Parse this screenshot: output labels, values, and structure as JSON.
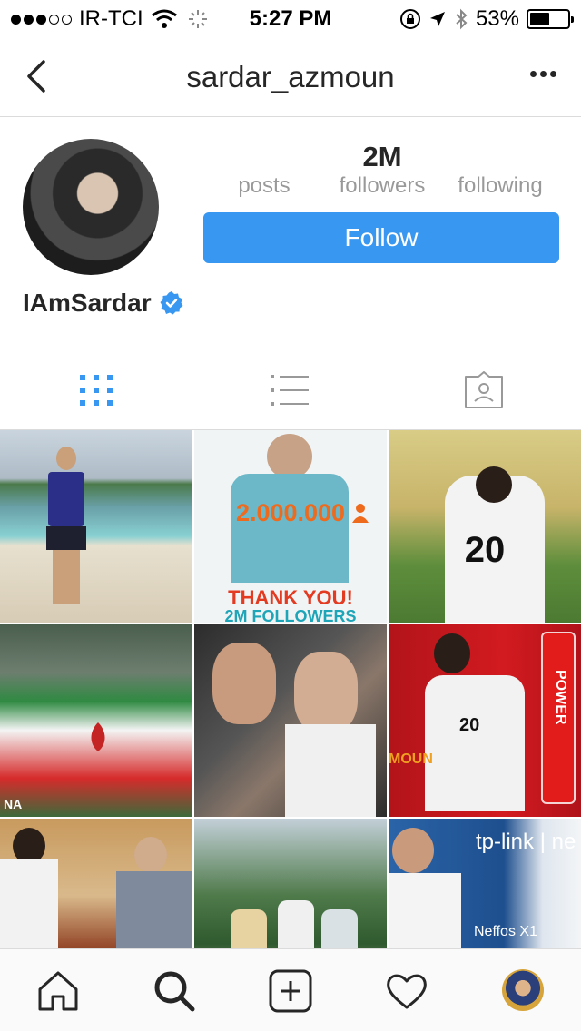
{
  "status_bar": {
    "carrier": "IR-TCI",
    "time": "5:27 PM",
    "battery": "53%",
    "battery_level": 0.53,
    "signal_bars_filled": 3,
    "signal_bars_total": 5
  },
  "nav": {
    "title": "sardar_azmoun",
    "back_icon": "chevron-left-icon",
    "more_icon": "more-horizontal-icon"
  },
  "profile": {
    "posts_label": "posts",
    "followers_count": "2M",
    "followers_label": "followers",
    "following_label": "following",
    "follow_button": "Follow",
    "full_name": "IAmSardar",
    "verified": true
  },
  "view_tabs": [
    {
      "name": "grid-view",
      "icon": "grid-icon",
      "active": true
    },
    {
      "name": "list-view",
      "icon": "list-icon",
      "active": false
    },
    {
      "name": "tagged-view",
      "icon": "tagged-person-icon",
      "active": false
    }
  ],
  "grid_posts": [
    {
      "caption": ""
    },
    {
      "caption": "2.000.000",
      "caption2": "THANK YOU!",
      "caption3": "2M FOLLOWERS"
    },
    {
      "caption": "20"
    },
    {
      "caption": "NA"
    },
    {
      "caption": ""
    },
    {
      "caption": "POWER",
      "caption2": "MOUN",
      "caption3": "20"
    },
    {
      "caption": ""
    },
    {
      "caption": ""
    },
    {
      "caption": "tp-link | ne",
      "caption2": "Neffos X1"
    }
  ],
  "bottom_bar": [
    {
      "name": "home",
      "icon": "home-icon"
    },
    {
      "name": "search",
      "icon": "search-icon"
    },
    {
      "name": "new-post",
      "icon": "plus-square-icon"
    },
    {
      "name": "activity",
      "icon": "heart-icon"
    },
    {
      "name": "profile",
      "icon": "profile-avatar-icon"
    }
  ],
  "colors": {
    "accent": "#3897f0",
    "text": "#262626",
    "muted": "#999999",
    "divider": "#dbdbdb"
  }
}
